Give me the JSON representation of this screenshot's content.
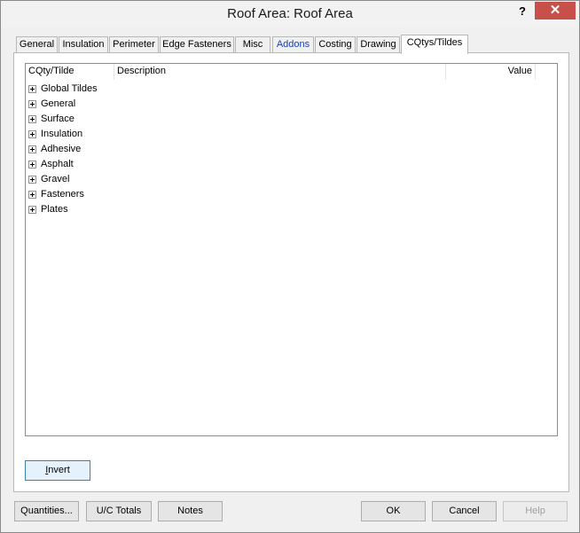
{
  "window": {
    "title": "Roof Area: Roof Area",
    "help_label": "?",
    "close_label": "✕"
  },
  "tabs": [
    {
      "label": "General"
    },
    {
      "label": "Insulation"
    },
    {
      "label": "Perimeter"
    },
    {
      "label": "Edge Fasteners"
    },
    {
      "label": "Misc"
    },
    {
      "label": "Addons"
    },
    {
      "label": "Costing"
    },
    {
      "label": "Drawing"
    },
    {
      "label": "CQtys/Tildes",
      "selected": true
    }
  ],
  "tree": {
    "columns": {
      "name": "CQty/Tilde",
      "description": "Description",
      "value": "Value"
    },
    "items": [
      {
        "label": "Global Tildes"
      },
      {
        "label": "General"
      },
      {
        "label": "Surface"
      },
      {
        "label": "Insulation"
      },
      {
        "label": "Adhesive"
      },
      {
        "label": "Asphalt"
      },
      {
        "label": "Gravel"
      },
      {
        "label": "Fasteners"
      },
      {
        "label": "Plates"
      }
    ]
  },
  "panel": {
    "invert_label_mnemonic": "I",
    "invert_label_rest": "nvert"
  },
  "footer": {
    "quantities_label": "Quantities...",
    "uc_totals_label": "U/C Totals",
    "notes_label": "Notes",
    "ok_label": "OK",
    "cancel_label": "Cancel",
    "help_label": "Help"
  },
  "colors": {
    "close_button": "#c7504b",
    "addons_tab_text": "#1b3fa6",
    "focus_border": "#3c7fb1"
  }
}
